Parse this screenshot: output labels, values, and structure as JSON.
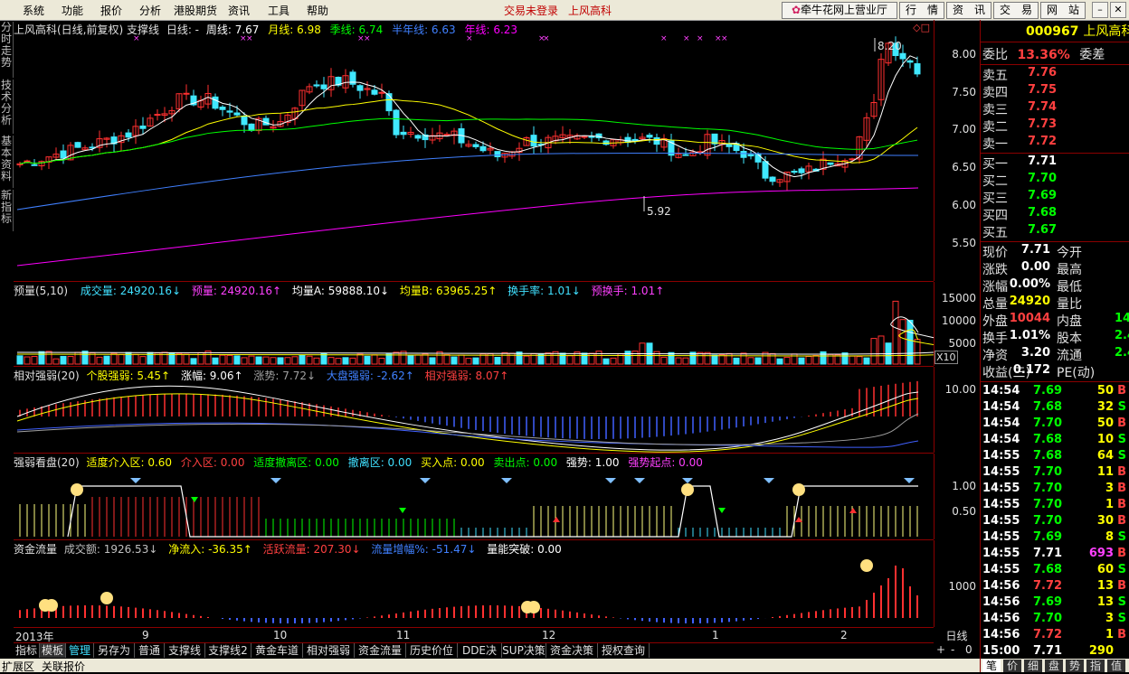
{
  "menu": {
    "items": [
      "系统",
      "功能",
      "报价",
      "分析",
      "港股期货",
      "资讯",
      "工具",
      "帮助"
    ],
    "trade_status": "交易未登录",
    "stock_name": "上风高科",
    "broker": "牵牛花网上营业厅",
    "buttons": [
      "行　情",
      "资　讯",
      "交　易",
      "网　站"
    ]
  },
  "left_tabs": [
    "分时走势",
    "技术分析",
    "基本资料",
    "新指标"
  ],
  "kline": {
    "title": "上风高科(日线,前复权) 支撑线",
    "period": "日线: -",
    "ma": [
      {
        "label": "周线: 7.67",
        "color": "#ffffff"
      },
      {
        "label": "月线: 6.98",
        "color": "#ffff00"
      },
      {
        "label": "季线: 6.74",
        "color": "#00ff00"
      },
      {
        "label": "半年线: 6.63",
        "color": "#4080ff"
      },
      {
        "label": "年线: 6.23",
        "color": "#ff00ff"
      }
    ],
    "y_ticks": [
      "8.00",
      "7.50",
      "7.00",
      "6.50",
      "6.00",
      "5.50"
    ],
    "high_label": "8.20",
    "low_label": "5.92"
  },
  "volume": {
    "title": "预量(5,10)",
    "items": [
      {
        "label": "成交量: 24920.16↓",
        "color": "#40e0ff"
      },
      {
        "label": "预量: 24920.16↑",
        "color": "#ff40ff"
      },
      {
        "label": "均量A: 59888.10↓",
        "color": "#ffffff"
      },
      {
        "label": "均量B: 63965.25↑",
        "color": "#ffff00"
      },
      {
        "label": "换手率: 1.01↓",
        "color": "#40e0ff"
      },
      {
        "label": "预换手: 1.01↑",
        "color": "#ff40ff"
      }
    ],
    "y_ticks": [
      "15000",
      "10000",
      "5000"
    ],
    "unit": "X10"
  },
  "strength": {
    "title": "相对强弱(20)",
    "items": [
      {
        "label": "个股强弱: 5.45↑",
        "color": "#ffff00"
      },
      {
        "label": "涨幅: 9.06↑",
        "color": "#ffffff"
      },
      {
        "label": "涨势: 7.72↓",
        "color": "#a0a0a0"
      },
      {
        "label": "大盘强弱: -2.62↑",
        "color": "#4080ff"
      },
      {
        "label": "相对强弱: 8.07↑",
        "color": "#ff4040"
      }
    ],
    "y_ticks": [
      "10.00"
    ]
  },
  "board": {
    "title": "强弱看盘(20)",
    "items": [
      {
        "label": "适度介入区: 0.60",
        "color": "#ffff00"
      },
      {
        "label": "介入区: 0.00",
        "color": "#ff4040"
      },
      {
        "label": "适度撤离区: 0.00",
        "color": "#00ff00"
      },
      {
        "label": "撤离区: 0.00",
        "color": "#40e0ff"
      },
      {
        "label": "买入点: 0.00",
        "color": "#ffff00"
      },
      {
        "label": "卖出点: 0.00",
        "color": "#00ff00"
      },
      {
        "label": "强势: 1.00",
        "color": "#ffffff"
      },
      {
        "label": "强势起点: 0.00",
        "color": "#ff40ff"
      }
    ],
    "y_ticks": [
      "1.00",
      "0.50"
    ]
  },
  "fund": {
    "title": "资金流量",
    "items": [
      {
        "label": "成交额: 1926.53↓",
        "color": "#c0c0c0"
      },
      {
        "label": "净流入: -36.35↑",
        "color": "#ffff00"
      },
      {
        "label": "活跃流量: 207.30↓",
        "color": "#ff4040"
      },
      {
        "label": "流量增幅%: -51.47↓",
        "color": "#4080ff"
      },
      {
        "label": "量能突破: 0.00",
        "color": "#ffffff"
      }
    ],
    "y_ticks": [
      "1000"
    ]
  },
  "x_axis": {
    "labels": [
      "2013年",
      "9",
      "10",
      "11",
      "12",
      "1",
      "2"
    ],
    "period": "日线"
  },
  "bottom_tabs": [
    "指标",
    "模板",
    "管理",
    "另存为",
    "普通",
    "支撑线",
    "支撑线2",
    "黄金车道",
    "相对强弱",
    "资金流量",
    "历史价位",
    "DDE决策",
    "SUP决策",
    "资金决策",
    "授权查询"
  ],
  "nav_buttons": [
    "+",
    "-",
    "0"
  ],
  "status": [
    "扩展区",
    "关联报价"
  ],
  "quote": {
    "code": "000967",
    "name": "上风高科",
    "weibi_label": "委比",
    "weibi": "13.36%",
    "weicha_label": "委差",
    "sells": [
      [
        "卖五",
        "7.76"
      ],
      [
        "卖四",
        "7.75"
      ],
      [
        "卖三",
        "7.74"
      ],
      [
        "卖二",
        "7.73"
      ],
      [
        "卖一",
        "7.72"
      ]
    ],
    "buys": [
      [
        "买一",
        "7.71"
      ],
      [
        "买二",
        "7.70"
      ],
      [
        "买三",
        "7.69"
      ],
      [
        "买四",
        "7.68"
      ],
      [
        "买五",
        "7.67"
      ]
    ],
    "stats": [
      [
        "现价",
        "7.71",
        "今开",
        ""
      ],
      [
        "涨跌",
        "0.00",
        "最高",
        ""
      ],
      [
        "涨幅",
        "0.00%",
        "最低",
        ""
      ],
      [
        "总量",
        "24920",
        "量比",
        ""
      ],
      [
        "外盘",
        "10044",
        "内盘",
        "14"
      ],
      [
        "换手",
        "1.01%",
        "股本",
        "2.4"
      ],
      [
        "净资",
        "3.20",
        "流通",
        "2.4"
      ],
      [
        "收益(三)",
        "0.172",
        "PE(动)",
        ""
      ]
    ],
    "ticks": [
      [
        "14:54",
        "7.69",
        "50",
        "B"
      ],
      [
        "14:54",
        "7.68",
        "32",
        "S"
      ],
      [
        "14:54",
        "7.70",
        "50",
        "B"
      ],
      [
        "14:54",
        "7.68",
        "10",
        "S"
      ],
      [
        "14:55",
        "7.68",
        "64",
        "S"
      ],
      [
        "14:55",
        "7.70",
        "11",
        "B"
      ],
      [
        "14:55",
        "7.70",
        "3",
        "B"
      ],
      [
        "14:55",
        "7.70",
        "1",
        "B"
      ],
      [
        "14:55",
        "7.70",
        "30",
        "B"
      ],
      [
        "14:55",
        "7.69",
        "8",
        "S"
      ],
      [
        "14:55",
        "7.71",
        "693",
        "B"
      ],
      [
        "14:55",
        "7.68",
        "60",
        "S"
      ],
      [
        "14:56",
        "7.72",
        "13",
        "B"
      ],
      [
        "14:56",
        "7.69",
        "13",
        "S"
      ],
      [
        "14:56",
        "7.70",
        "3",
        "S"
      ],
      [
        "14:56",
        "7.72",
        "1",
        "B"
      ],
      [
        "15:00",
        "7.71",
        "290",
        ""
      ]
    ],
    "tabs": [
      "笔",
      "价",
      "细",
      "盘",
      "势",
      "指",
      "值"
    ]
  }
}
